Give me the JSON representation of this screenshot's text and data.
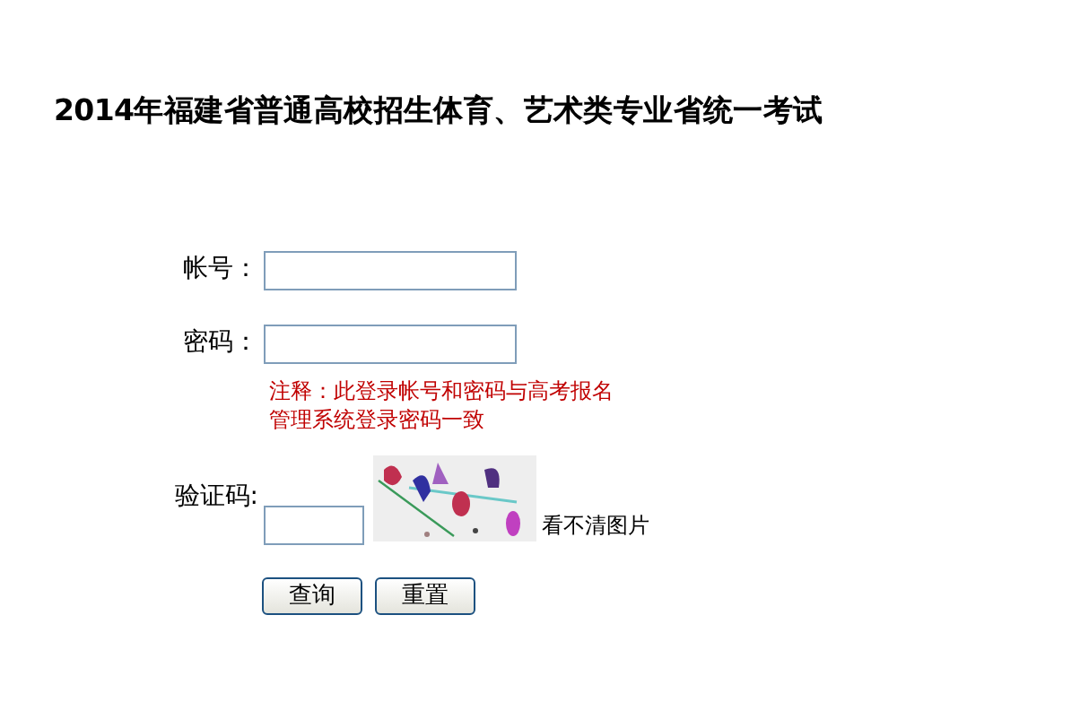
{
  "title": "2014年福建省普通高校招生体育、艺术类专业省统一考试",
  "fields": [
    {
      "label": "帐号："
    },
    {
      "label": "密码："
    }
  ],
  "note_lines": [
    "注释：此登录帐号和密码与高考报名",
    "管理系统登录密码一致"
  ],
  "captcha": {
    "label": "验证码:",
    "refresh_link": "看不清图片"
  },
  "buttons": [
    "查询",
    "重置"
  ]
}
